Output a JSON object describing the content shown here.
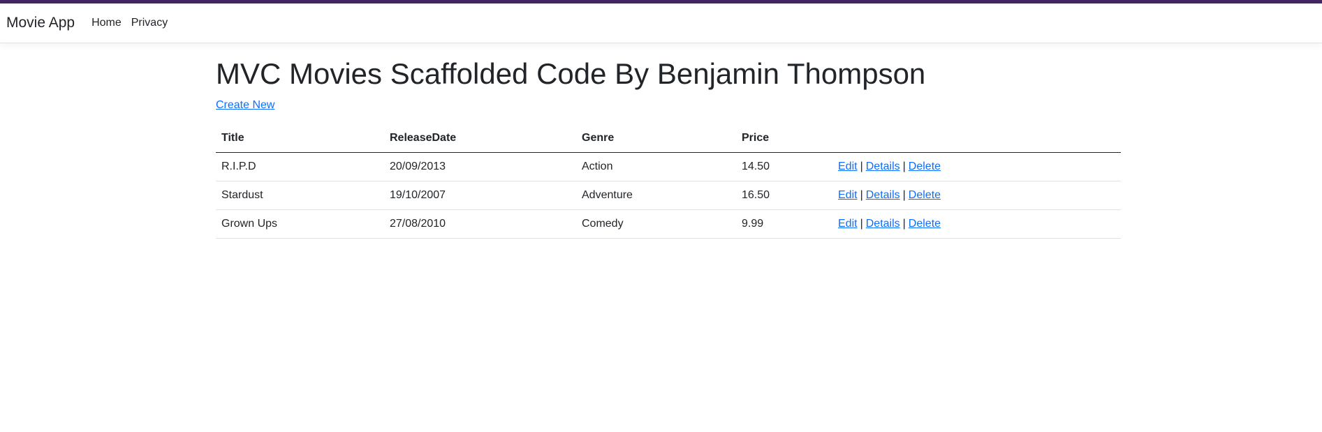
{
  "navbar": {
    "brand": "Movie App",
    "links": [
      "Home",
      "Privacy"
    ]
  },
  "page": {
    "title": "MVC Movies Scaffolded Code By Benjamin Thompson",
    "create_link": "Create New"
  },
  "table": {
    "headers": [
      "Title",
      "ReleaseDate",
      "Genre",
      "Price",
      ""
    ],
    "rows": [
      {
        "title": "R.I.P.D",
        "release_date": "20/09/2013",
        "genre": "Action",
        "price": "14.50"
      },
      {
        "title": "Stardust",
        "release_date": "19/10/2007",
        "genre": "Adventure",
        "price": "16.50"
      },
      {
        "title": "Grown Ups",
        "release_date": "27/08/2010",
        "genre": "Comedy",
        "price": "9.99"
      }
    ],
    "actions": {
      "edit": "Edit",
      "details": "Details",
      "delete": "Delete",
      "separator": "|"
    }
  },
  "colors": {
    "top_stripe": "#43285f",
    "link": "#0d6efd",
    "text": "#212529"
  }
}
